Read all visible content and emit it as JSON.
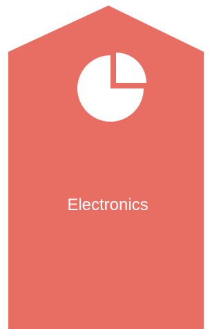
{
  "card": {
    "label": "Electronics",
    "icon": "pie-chart-icon",
    "fill_color": "#E86E63",
    "icon_color": "#FFFFFF",
    "text_color": "#FFFFFF"
  }
}
